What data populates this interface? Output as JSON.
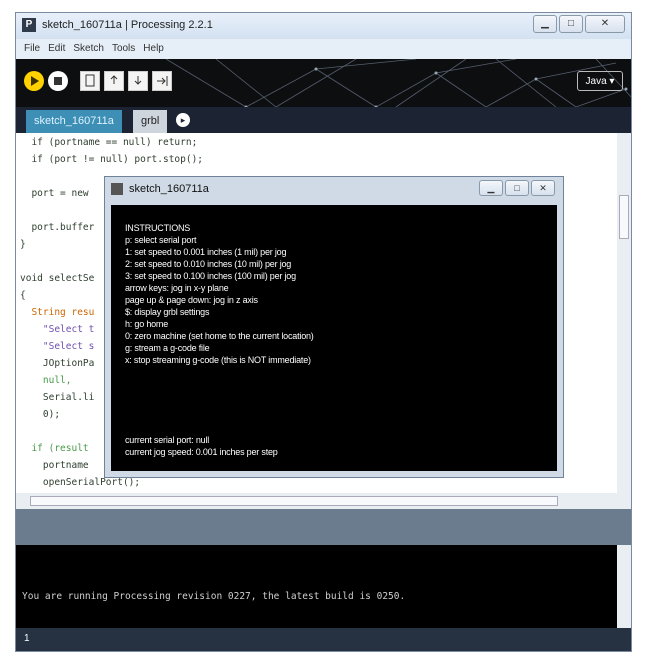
{
  "window": {
    "title": "sketch_160711a | Processing 2.2.1",
    "icon": "processing-app-icon",
    "controls": [
      "minimize-icon",
      "maximize-icon",
      "close-icon"
    ]
  },
  "menu": [
    "File",
    "Edit",
    "Sketch",
    "Tools",
    "Help"
  ],
  "toolbar": {
    "buttons": [
      "run-icon",
      "stop-icon",
      "new-icon",
      "open-icon",
      "save-icon",
      "export-icon"
    ],
    "mode_label": "Java"
  },
  "tabs": [
    {
      "label": "sketch_160711a",
      "active": true
    },
    {
      "label": "grbl",
      "active": false
    }
  ],
  "code_lines": [
    "  if (portname == null) return;",
    "  if (port != null) port.stop();",
    "",
    "  port = new",
    "",
    "  port.buffer",
    "}",
    "",
    "void selectSe",
    "{",
    "  String resu",
    "    \"Select t",
    "    \"Select s",
    "    JOptionPa",
    "    null,",
    "    Serial.li",
    "    0);",
    "",
    "  if (result",
    "    portname",
    "    openSerialPort();"
  ],
  "console": {
    "message": "You are running Processing revision 0227, the latest build is 0250."
  },
  "status": {
    "line_number": "1"
  },
  "popup": {
    "title": "sketch_160711a",
    "lines": [
      "INSTRUCTIONS",
      "p: select serial port",
      "1: set speed to 0.001 inches (1 mil) per jog",
      "2: set speed to 0.010 inches (10 mil) per jog",
      "3: set speed to 0.100 inches (100 mil) per jog",
      "arrow keys: jog in x-y plane",
      "page up & page down: jog in z axis",
      "$: display grbl settings",
      "h: go home",
      "0: zero machine (set home to the current location)",
      "g: stream a g-code file",
      "x: stop streaming g-code (this is NOT immediate)"
    ],
    "footer": [
      "current serial port: null",
      "current jog speed: 0.001 inches per step"
    ]
  },
  "colors": {
    "toolbar_bg": "#0d0e10",
    "run_button": "#ffd200",
    "active_tab": "#3d8fb5",
    "console_bg": "#000000",
    "status_bg": "#263241"
  }
}
